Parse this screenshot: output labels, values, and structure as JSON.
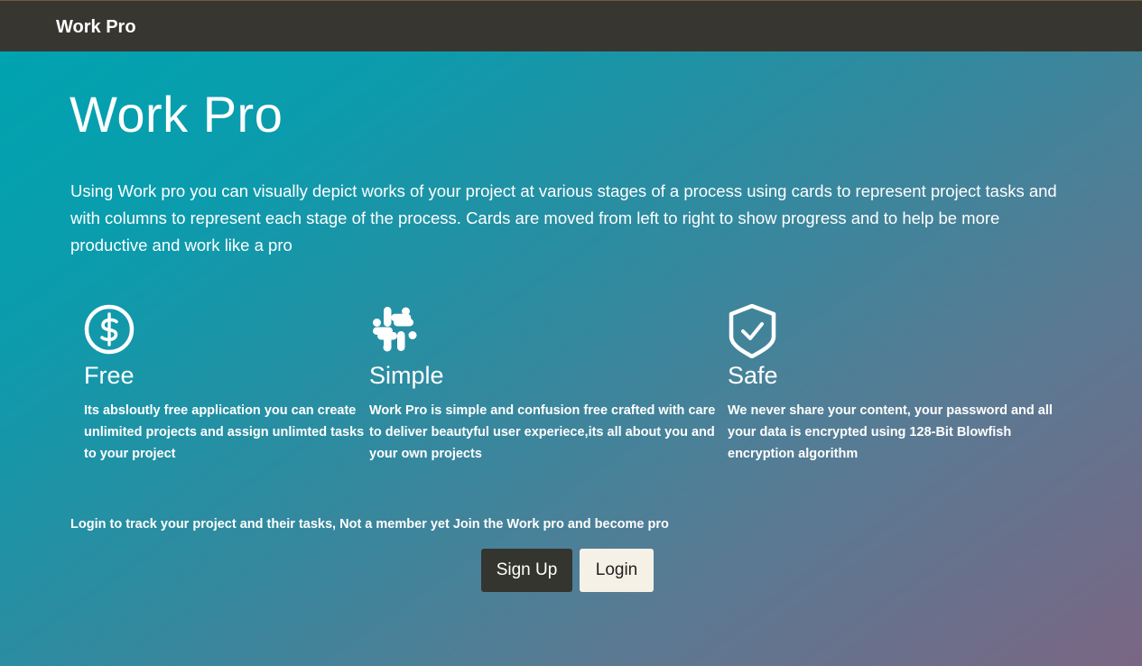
{
  "navbar": {
    "brand": "Work Pro"
  },
  "hero": {
    "title": "Work Pro",
    "intro": "Using Work pro you can visually depict works of your project at various stages of a process using cards to represent project tasks and with columns to represent each stage of the process. Cards are moved from left to right to show progress and to help be more productive and work like a pro",
    "features": [
      {
        "icon": "dollar-circle-icon",
        "title": "Free",
        "text": "Its absloutly free application you can create unlimited projects and assign unlimted tasks to your project"
      },
      {
        "icon": "slack-icon",
        "title": "Simple",
        "text": "Work Pro is simple and confusion free crafted with care to deliver beautyful user experiece,its all about you and your own projects"
      },
      {
        "icon": "shield-check-icon",
        "title": "Safe",
        "text": "We never share your content, your password and all your data is encrypted using 128-Bit Blowfish encryption algorithm"
      }
    ],
    "cta_text": "Login to track your project and their tasks, Not a member yet Join the Work pro and become pro",
    "signup_label": "Sign Up",
    "login_label": "Login"
  },
  "colors": {
    "navbar": "#373631",
    "gradient_start": "#00a3b0",
    "gradient_end": "#7a6684",
    "signup_button": "#353530",
    "login_button": "#f6f1e6"
  }
}
